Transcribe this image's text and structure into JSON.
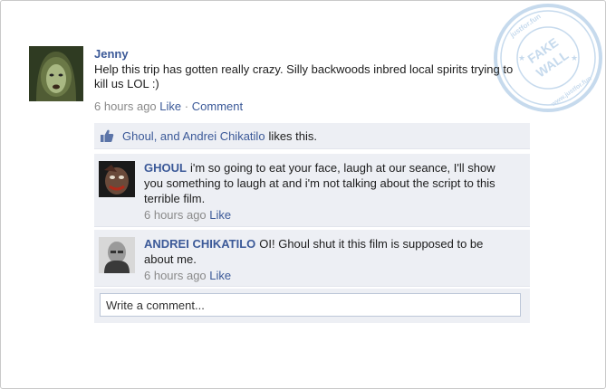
{
  "post": {
    "author": "Jenny",
    "text": "Help this trip has gotten really crazy. Silly backwoods inbred local spirits trying to kill us LOL :)",
    "time": "6 hours ago",
    "like_label": "Like",
    "separator": "·",
    "comment_label": "Comment"
  },
  "likes": {
    "names": "Ghoul, and Andrei Chikatilo",
    "suffix": "likes this."
  },
  "comments": [
    {
      "author": "GHOUL",
      "text": "i'm so going to eat your face, laugh at our seance, I'll show you something to laugh at and i'm not talking about the script to this terrible film.",
      "time": "6 hours ago",
      "like_label": "Like"
    },
    {
      "author": "ANDREI CHIKATILO",
      "text": "OI! Ghoul shut it this film is supposed to be about me.",
      "time": "6 hours ago",
      "like_label": "Like"
    }
  ],
  "composer": {
    "placeholder": "Write a comment..."
  },
  "watermark": {
    "top_text": "justfor.fun",
    "middle_text": "FAKE WALL",
    "bottom_text": "www.justfor.fun"
  },
  "icons": {
    "like": "thumbs-up-icon",
    "watermark": "stamp-seal"
  },
  "colors": {
    "link": "#3b5998",
    "meta": "#8a8a8a",
    "feedback_bg": "#edeff4",
    "input_border": "#bdc7d8"
  }
}
